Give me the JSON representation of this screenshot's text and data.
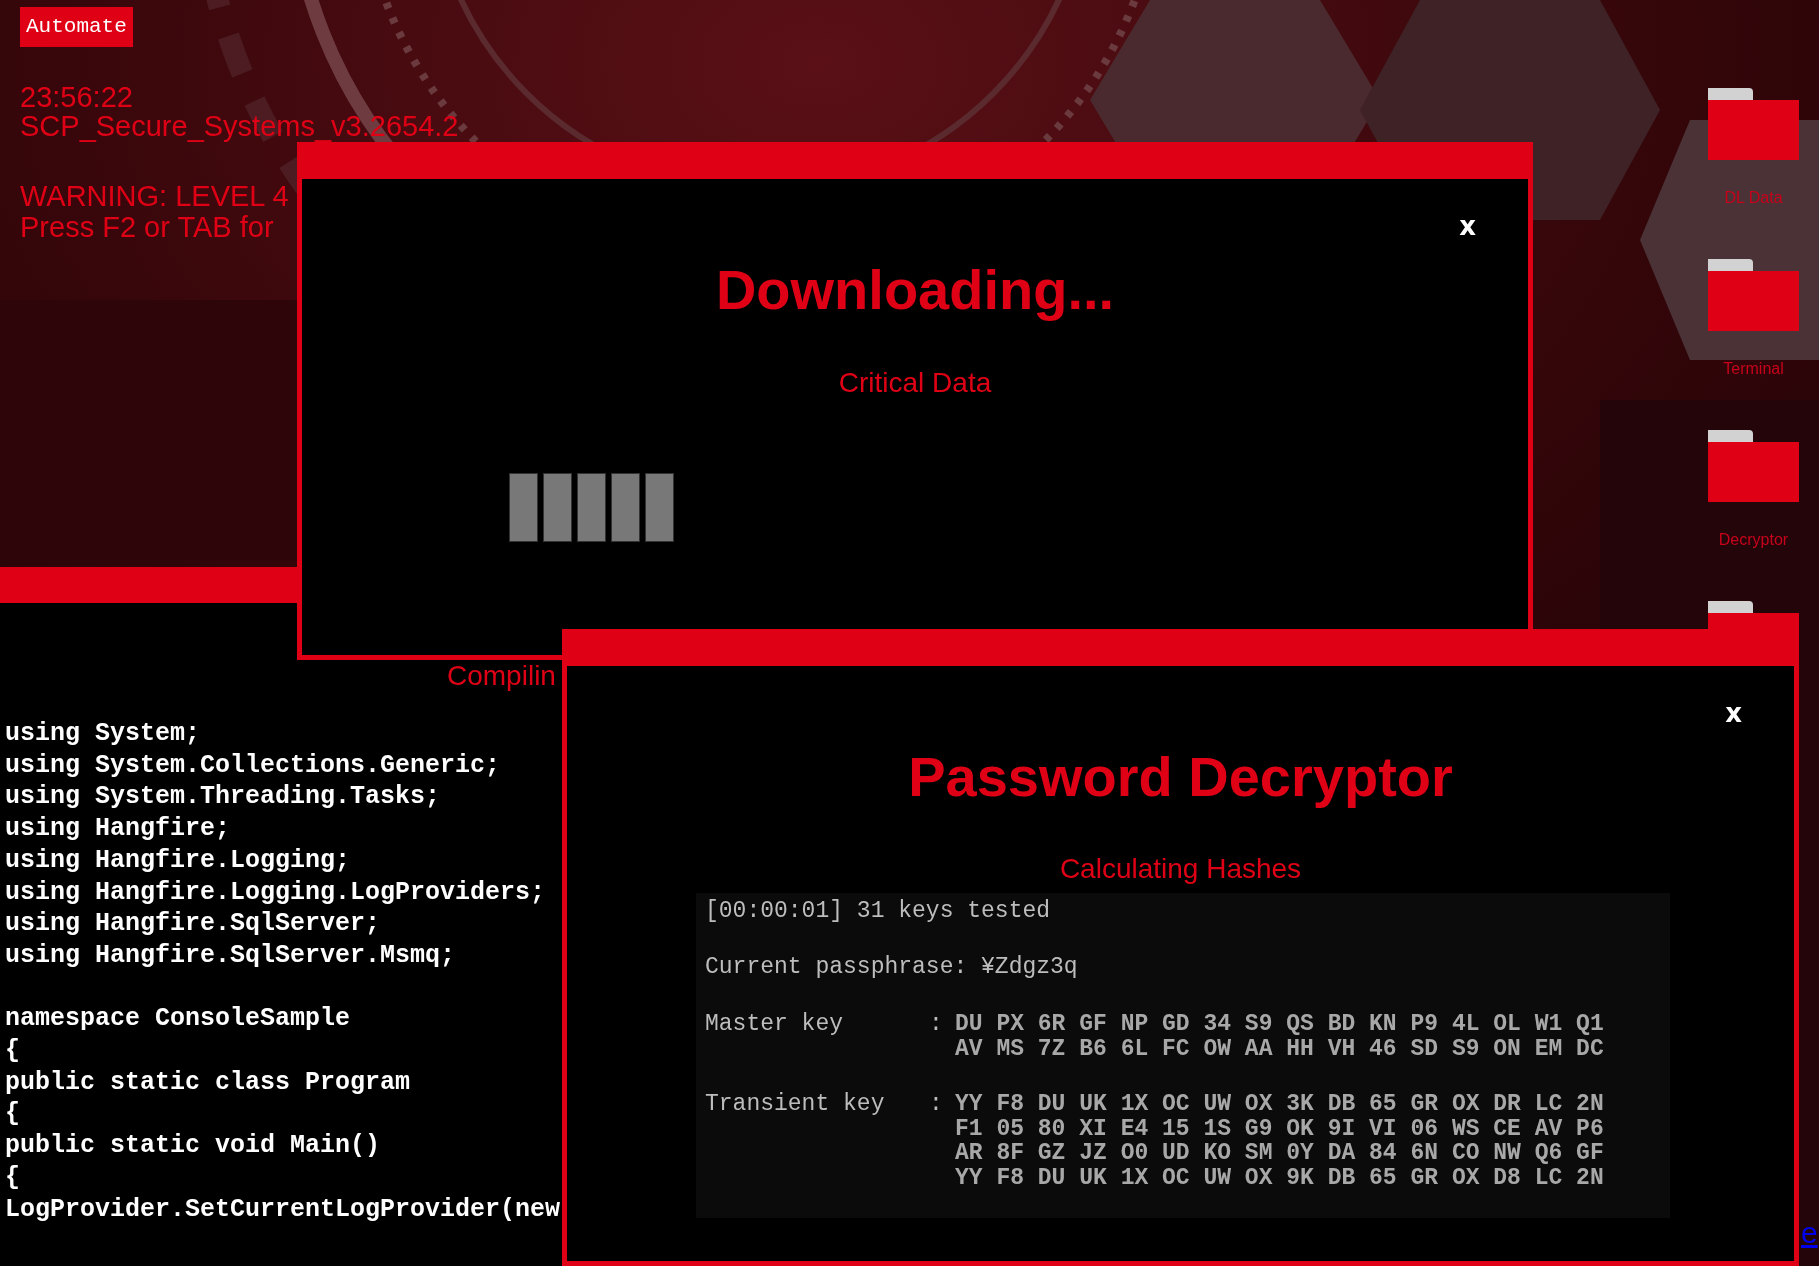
{
  "automate_button": "Automate",
  "status": {
    "time": "23:56:22",
    "system": "SCP_Secure_Systems_v3.2654.2",
    "warning": "WARNING: LEVEL 4",
    "hint": "Press F2 or TAB for"
  },
  "desktop_icons": [
    {
      "kind": "folder",
      "label": "DL Data"
    },
    {
      "kind": "folder",
      "label": "Terminal"
    },
    {
      "kind": "folder",
      "label": "Decryptor"
    },
    {
      "kind": "folder_peek"
    }
  ],
  "terminal_window": {
    "status": "Compilin",
    "code_blocks": [
      [
        "using System;",
        "using System.Collections.Generic;",
        "using System.Threading.Tasks;",
        "using Hangfire;",
        "using Hangfire.Logging;",
        "using Hangfire.Logging.LogProviders;",
        "using Hangfire.SqlServer;",
        "using Hangfire.SqlServer.Msmq;"
      ],
      [
        "namespace ConsoleSample",
        "{",
        "public static class Program",
        "{",
        "public static void Main()",
        "{",
        "LogProvider.SetCurrentLogProvider(new"
      ]
    ]
  },
  "download_window": {
    "title": "Downloading...",
    "subtitle": "Critical Data",
    "close": "x"
  },
  "decryptor_window": {
    "title": "Password Decryptor",
    "subtitle": "Calculating Hashes",
    "close": "x",
    "log": {
      "elapsed": "[00:00:01] 31 keys tested",
      "passphrase": "Current passphrase: ¥Zdgz3q",
      "keys": [
        {
          "label": "Master key",
          "separator": ":",
          "lines": [
            "DU PX 6R GF NP GD 34 S9 QS BD KN P9 4L OL W1 Q1",
            "AV MS 7Z B6 6L FC OW AA HH VH 46 SD S9 ON EM DC"
          ]
        },
        {
          "label": "Transient key",
          "separator": ":",
          "lines": [
            "YY F8 DU UK 1X OC UW OX 3K DB 65 GR OX DR LC 2N",
            "F1 05 80 XI E4 15 1S G9 OK 9I VI 06 WS CE AV P6",
            "AR 8F GZ JZ O0 UD KO SM 0Y DA 84 6N CO NW Q6 GF",
            "YY F8 DU UK 1X OC UW OX 9K DB 65 GR OX D8 LC 2N"
          ]
        }
      ]
    }
  },
  "link": "e"
}
